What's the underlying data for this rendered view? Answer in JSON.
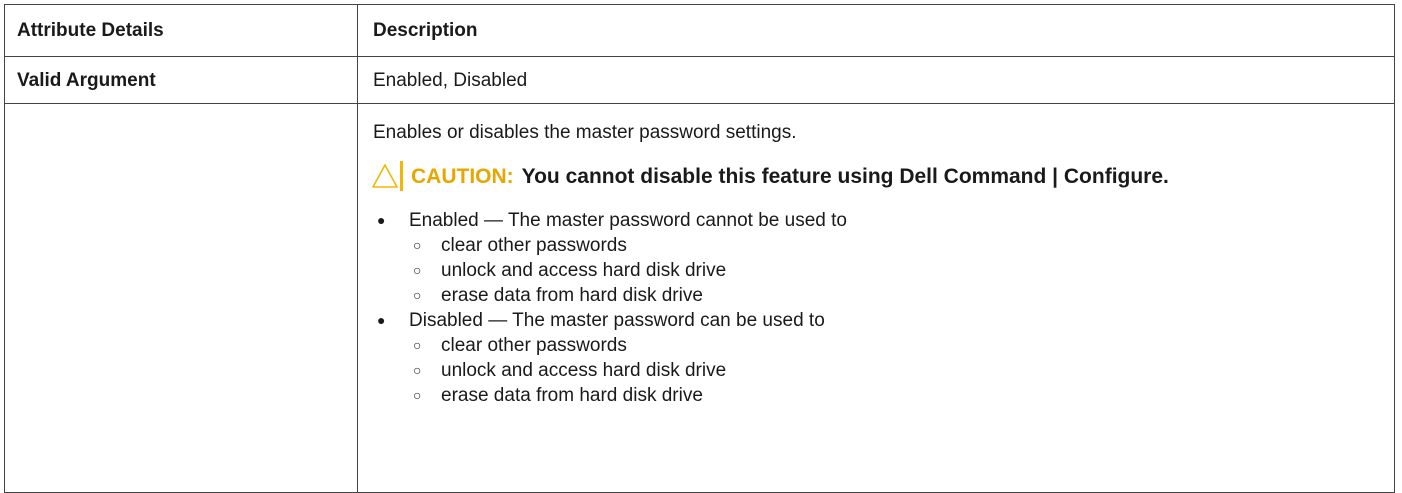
{
  "table": {
    "headers": {
      "attribute": "Attribute Details",
      "description": "Description"
    },
    "valid_argument": {
      "label": "Valid Argument",
      "value": "Enabled, Disabled"
    },
    "details": {
      "attr": "",
      "intro": "Enables or disables the master password settings.",
      "caution_label": "CAUTION:",
      "caution_text": "You cannot disable this feature using Dell Command | Configure.",
      "options": [
        {
          "text": "Enabled — The master password cannot be used to",
          "subitems": [
            "clear other passwords",
            "unlock and access hard disk drive",
            "erase data from hard disk drive"
          ]
        },
        {
          "text": "Disabled — The master password can be used to",
          "subitems": [
            "clear other passwords",
            "unlock and access hard disk drive",
            "erase data from hard disk drive"
          ]
        }
      ]
    }
  },
  "colors": {
    "caution": "#e8a700",
    "border": "#444444"
  },
  "icons": {
    "caution": "warning-triangle-icon"
  }
}
